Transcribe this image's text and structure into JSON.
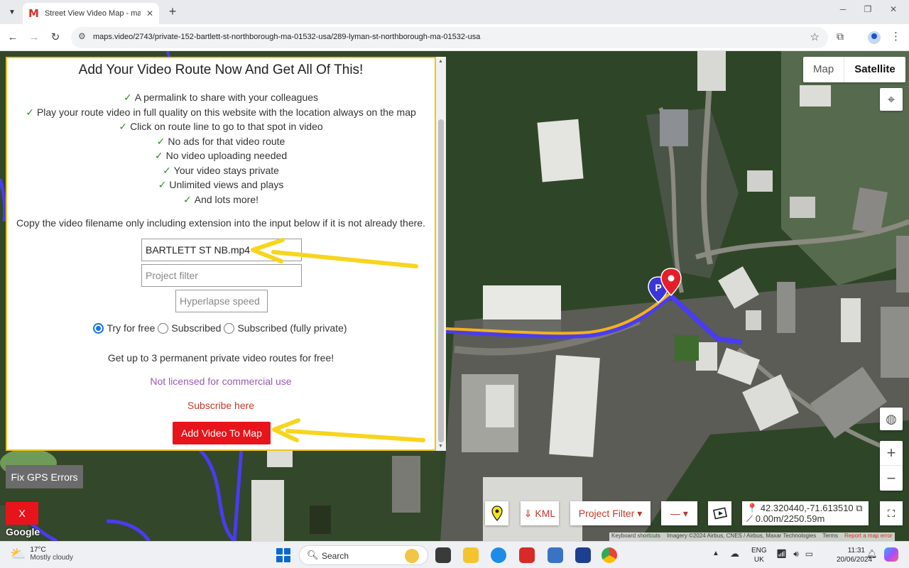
{
  "browser": {
    "tab_title": "Street View Video Map - maps.video",
    "tab_favicon": "M",
    "new_tab": "+",
    "url": "maps.video/2743/private-152-bartlett-st-northborough-ma-01532-usa/289-lyman-st-northborough-ma-01532-usa"
  },
  "map": {
    "type_map": "Map",
    "type_satellite": "Satellite",
    "zoom_in": "+",
    "zoom_out": "−",
    "marker_p": "P"
  },
  "panel": {
    "title": "Add Your Video Route Now And Get All Of This!",
    "features": [
      "A permalink to share with your colleagues",
      "Play your route video in full quality on this website with the location always on the map",
      "Click on route line to go to that spot in video",
      "No ads for that video route",
      "No video uploading needed",
      "Your video stays private",
      "Unlimited views and plays",
      "And lots more!"
    ],
    "check_glyph": "✓",
    "instruction": "Copy the video filename only including extension into the input below if it is not already there.",
    "filename_value": "BARTLETT ST NB.mp4",
    "project_placeholder": "Project filter",
    "hyperlapse_placeholder": "Hyperlapse speed",
    "radio_try": "Try for free",
    "radio_subscribed": "Subscribed",
    "radio_private": "Subscribed (fully private)",
    "free_note": "Get up to 3 permanent private video routes for free!",
    "license_link": "Not licensed for commercial use",
    "subscribe_link": "Subscribe here",
    "add_button": "Add Video To Map"
  },
  "controls": {
    "fix_gps": "Fix GPS Errors",
    "close_x": "X",
    "google": "Google",
    "kml": "⇓ KML",
    "project_filter": "Project Filter ▾",
    "line_select": "— ▾",
    "coords": "42.320440,-71.613510",
    "distance": "0.00m/2250.59m",
    "attribution": {
      "shortcuts": "Keyboard shortcuts",
      "imagery": "Imagery ©2024 Airbus, CNES / Airbus, Maxar Technologies",
      "terms": "Terms",
      "report": "Report a map error"
    }
  },
  "taskbar": {
    "temperature": "17°C",
    "weather": "Mostly cloudy",
    "search": "Search",
    "lang_1": "ENG",
    "lang_2": "UK",
    "time": "11:31",
    "date": "20/06/2024"
  },
  "colors": {
    "accent_red": "#e8141b",
    "panel_border": "#f0c419",
    "route_blue": "#4a3cf0",
    "route_yellow": "#f2b21b",
    "arrow_yellow": "#f7d51d"
  }
}
